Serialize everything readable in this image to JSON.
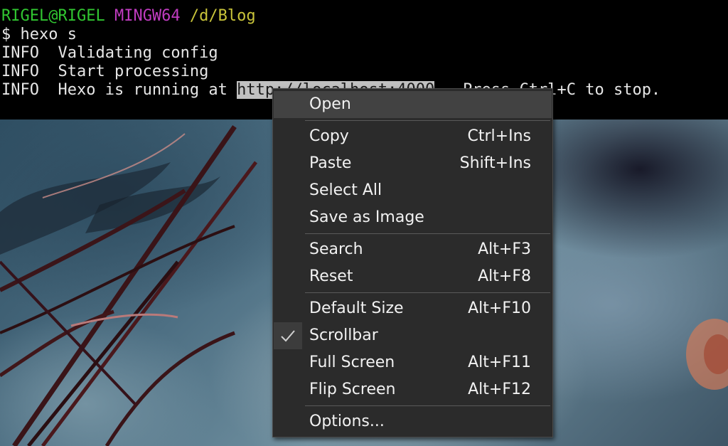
{
  "terminal": {
    "prompt_user": "RIGEL@RIGEL",
    "prompt_env": "MINGW64",
    "prompt_path": "/d/Blog",
    "command": "$ hexo s",
    "lines": [
      "INFO  Validating config",
      "INFO  Start processing"
    ],
    "running_prefix": "INFO  Hexo is running at ",
    "running_url": "http://localhost:4000",
    "running_suffix": " . Press Ctrl+C to stop."
  },
  "menu": {
    "open": "Open",
    "copy": {
      "label": "Copy",
      "shortcut": "Ctrl+Ins"
    },
    "paste": {
      "label": "Paste",
      "shortcut": "Shift+Ins"
    },
    "select_all": {
      "label": "Select All"
    },
    "save_image": {
      "label": "Save as Image"
    },
    "search": {
      "label": "Search",
      "shortcut": "Alt+F3"
    },
    "reset": {
      "label": "Reset",
      "shortcut": "Alt+F8"
    },
    "default_size": {
      "label": "Default Size",
      "shortcut": "Alt+F10"
    },
    "scrollbar": {
      "label": "Scrollbar",
      "checked": true
    },
    "full_screen": {
      "label": "Full Screen",
      "shortcut": "Alt+F11"
    },
    "flip_screen": {
      "label": "Flip Screen",
      "shortcut": "Alt+F12"
    },
    "options": {
      "label": "Options..."
    }
  },
  "icons": {
    "scrollbar_check": "checkmark-icon"
  },
  "colors": {
    "user": "#31c631",
    "env": "#c03cc0",
    "path": "#c9c43a",
    "menu_bg": "#2b2b2b",
    "menu_hover": "#424242"
  }
}
